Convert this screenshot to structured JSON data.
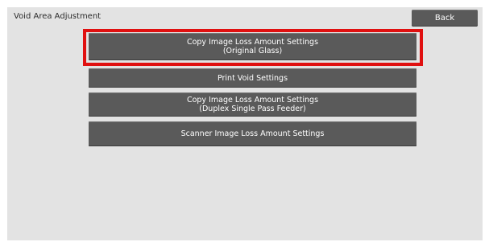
{
  "screen": {
    "title": "Void Area Adjustment",
    "back_label": "Back"
  },
  "menu": {
    "items": [
      {
        "line1": "Copy Image Loss Amount Settings",
        "line2": "(Original Glass)"
      },
      {
        "line1": "Print Void Settings",
        "line2": ""
      },
      {
        "line1": "Copy Image Loss Amount Settings",
        "line2": "(Duplex Single Pass Feeder)"
      },
      {
        "line1": "Scanner Image Loss Amount Settings",
        "line2": ""
      }
    ]
  },
  "colors": {
    "panel_bg": "#e3e3e3",
    "button_bg": "#5a5a5a",
    "button_text": "#ffffff",
    "highlight": "#e01010"
  }
}
